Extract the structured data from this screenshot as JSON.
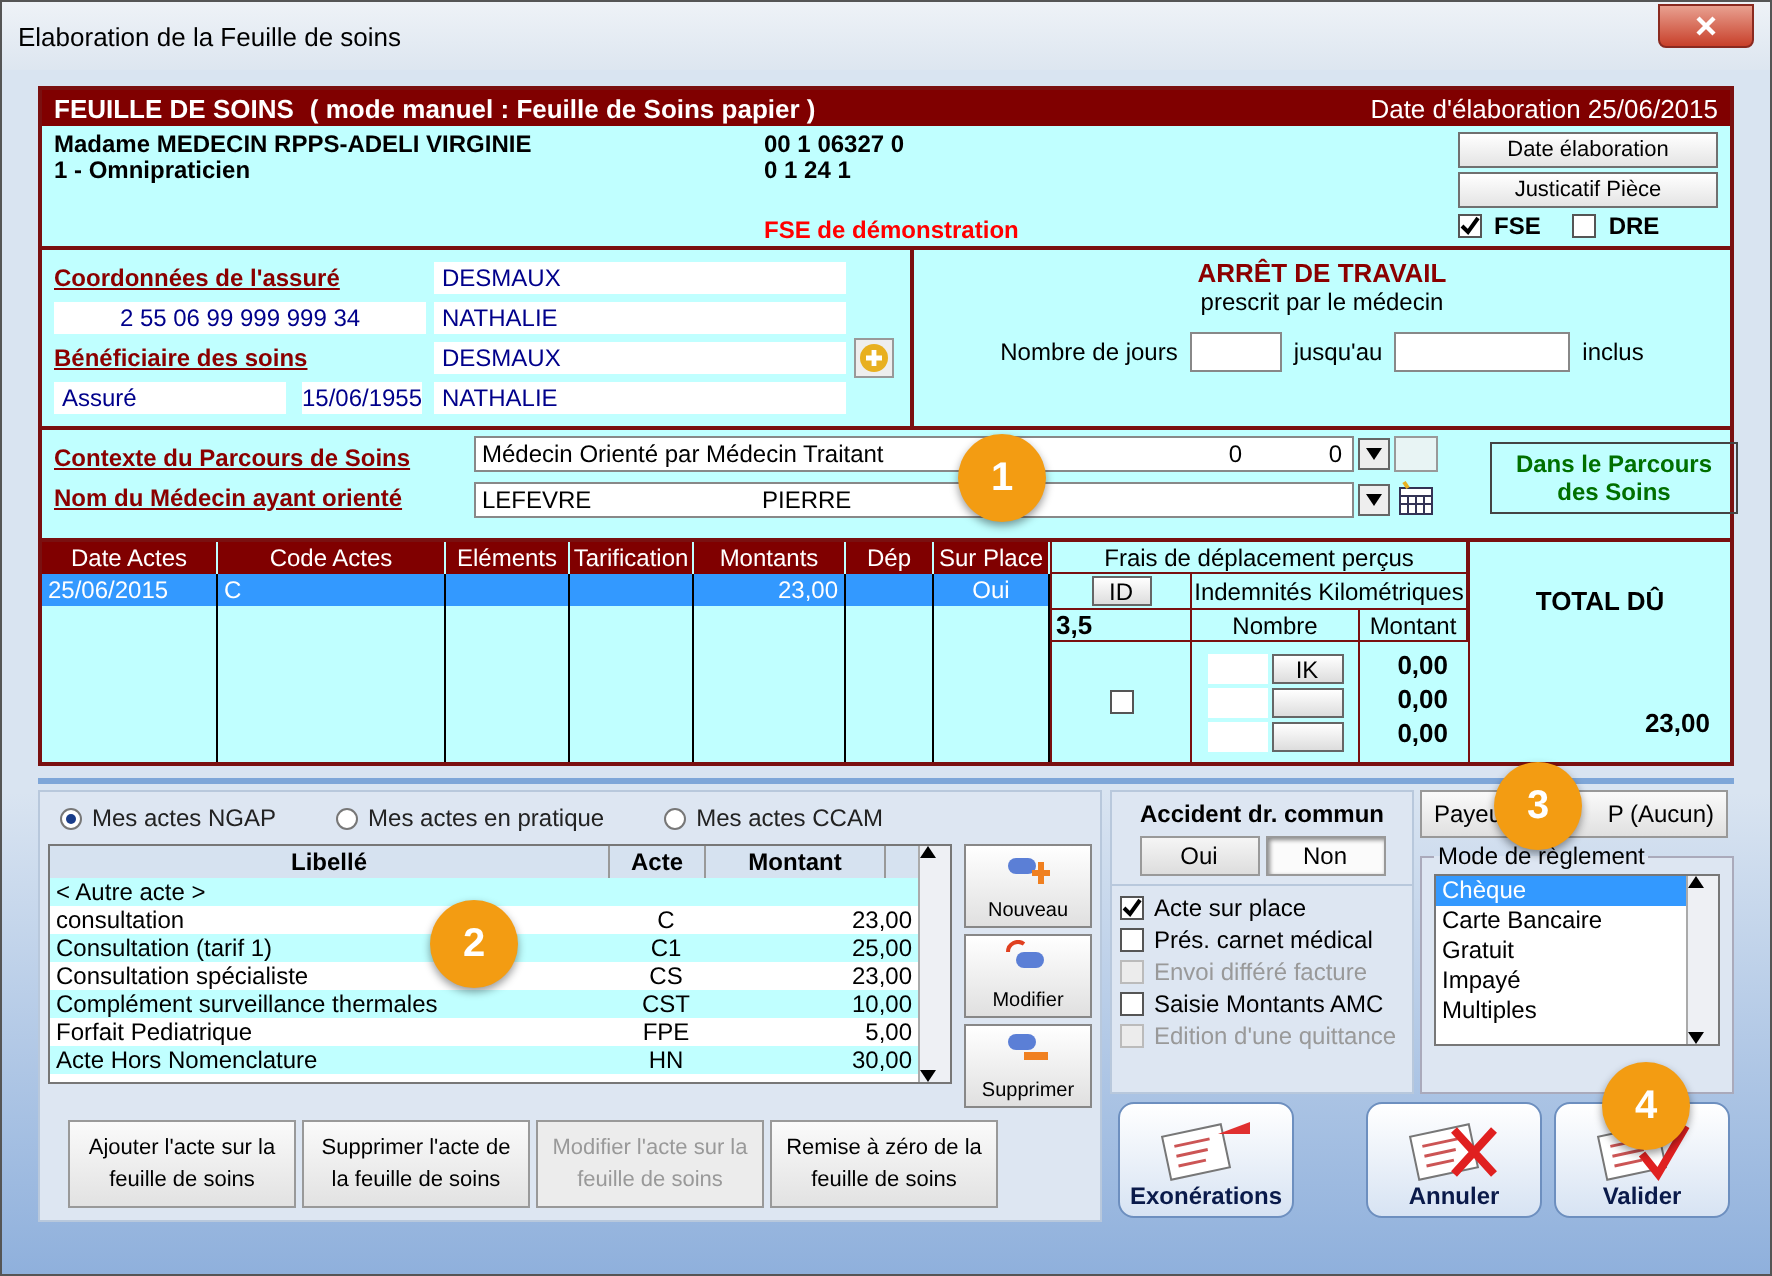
{
  "window": {
    "title": "Elaboration de la Feuille de soins"
  },
  "header": {
    "title": "FEUILLE DE SOINS",
    "mode": "( mode manuel : Feuille de Soins papier )",
    "date": "Date d'élaboration 25/06/2015"
  },
  "doctor": {
    "name": "Madame MEDECIN RPPS-ADELI VIRGINIE",
    "specialty": "1 - Omnipraticien",
    "number_1": "00 1 06327 0",
    "number_2": "0 1 24 1",
    "notice": "FSE de démonstration",
    "buttons": [
      "Date élaboration",
      "Justicatif Pièce"
    ],
    "checkboxes": [
      {
        "label": "FSE",
        "checked": true
      },
      {
        "label": "DRE",
        "checked": false
      }
    ]
  },
  "insured": {
    "label": "Coordonnées de l'assuré",
    "nir": "2 55 06 99 999 999 34",
    "last_name": "DESMAUX",
    "first_name": "NATHALIE"
  },
  "beneficiary": {
    "label": "Bénéficiaire des soins",
    "quality": "Assuré",
    "birth_date": "15/06/1955",
    "last_name": "DESMAUX",
    "first_name": "NATHALIE"
  },
  "sick_leave": {
    "title": "ARRÊT DE TRAVAIL",
    "subtitle": "prescrit par le médecin",
    "days_label": "Nombre de jours",
    "until_label": "jusqu'au",
    "included_label": "inclus"
  },
  "care_path": {
    "context_label": "Contexte du Parcours de Soins",
    "context_value": "Médecin Orienté par Médecin Traitant",
    "context_n1": "0",
    "context_n2": "0",
    "doctor_label": "Nom du Médecin ayant orienté",
    "doctor_last": "LEFEVRE",
    "doctor_first": "PIERRE",
    "status": "Dans le Parcours des Soins"
  },
  "acts_table": {
    "columns": [
      "Date Actes",
      "Code Actes",
      "Eléments",
      "Tarification",
      "Montants",
      "Dép",
      "Sur Place"
    ],
    "rows": [
      {
        "date": "25/06/2015",
        "code": "C",
        "amount": "23,00",
        "on_site": "Oui",
        "selected": true
      }
    ]
  },
  "travel": {
    "title": "Frais de déplacement perçus",
    "id_button": "ID",
    "ik_label": "Indemnités Kilométriques",
    "distance": "3,5",
    "count_header": "Nombre",
    "amount_header": "Montant",
    "ik_button": "IK",
    "checked": false,
    "amounts": [
      "0,00",
      "0,00",
      "0,00"
    ]
  },
  "total": {
    "label": "TOTAL DÛ",
    "value": "23,00"
  },
  "act_sources": [
    {
      "label": "Mes actes NGAP",
      "selected": true
    },
    {
      "label": "Mes actes en pratique",
      "selected": false
    },
    {
      "label": "Mes actes CCAM",
      "selected": false
    }
  ],
  "acts_list": {
    "columns": [
      "Libellé",
      "Acte",
      "Montant"
    ],
    "rows": [
      {
        "label": "< Autre acte >"
      },
      {
        "label": "consultation",
        "code": "C",
        "amount": "23,00"
      },
      {
        "label": "Consultation (tarif 1)",
        "code": "C1",
        "amount": "25,00"
      },
      {
        "label": "Consultation spécialiste",
        "code": "CS",
        "amount": "23,00"
      },
      {
        "label": "Complément surveillance thermales",
        "code": "CST",
        "amount": "10,00"
      },
      {
        "label": "Forfait Pediatrique",
        "code": "FPE",
        "amount": "5,00"
      },
      {
        "label": "Acte Hors Nomenclature",
        "code": "HN",
        "amount": "30,00"
      }
    ]
  },
  "side_buttons": [
    {
      "label": "Nouveau",
      "kind": "add"
    },
    {
      "label": "Modifier",
      "kind": "edit"
    },
    {
      "label": "Supprimer",
      "kind": "remove"
    }
  ],
  "action_buttons": [
    {
      "label": "Ajouter l'acte sur la feuille de soins",
      "disabled": false
    },
    {
      "label": "Supprimer l'acte de la feuille de soins",
      "disabled": false
    },
    {
      "label": "Modifier l'acte sur la feuille de soins",
      "disabled": true
    },
    {
      "label": "Remise à zéro de la feuille de soins",
      "disabled": false
    }
  ],
  "accident": {
    "title": "Accident dr. commun",
    "options": [
      {
        "label": "Oui",
        "selected": false
      },
      {
        "label": "Non",
        "selected": true
      }
    ]
  },
  "options": [
    {
      "label": "Acte sur place",
      "checked": true,
      "disabled": false
    },
    {
      "label": "Prés. carnet médical",
      "checked": false,
      "disabled": false
    },
    {
      "label": "Envoi différé facture",
      "checked": false,
      "disabled": true
    },
    {
      "label": "Saisie Montants AMC",
      "checked": false,
      "disabled": false
    },
    {
      "label": "Edition d'une quittance",
      "checked": false,
      "disabled": true
    }
  ],
  "payer": {
    "left": "Payeu",
    "right": "P (Aucun)"
  },
  "payment": {
    "title": "Mode de règlement",
    "items": [
      {
        "label": "Chèque",
        "selected": true
      },
      {
        "label": "Carte Bancaire",
        "selected": false
      },
      {
        "label": "Gratuit",
        "selected": false
      },
      {
        "label": "Impayé",
        "selected": false
      },
      {
        "label": "Multiples",
        "selected": false
      }
    ]
  },
  "big_buttons": [
    {
      "label": "Exonérations",
      "kind": "exemption"
    },
    {
      "label": "Annuler",
      "kind": "cancel"
    },
    {
      "label": "Valider",
      "kind": "validate"
    }
  ],
  "callouts": [
    "1",
    "2",
    "3",
    "4"
  ]
}
